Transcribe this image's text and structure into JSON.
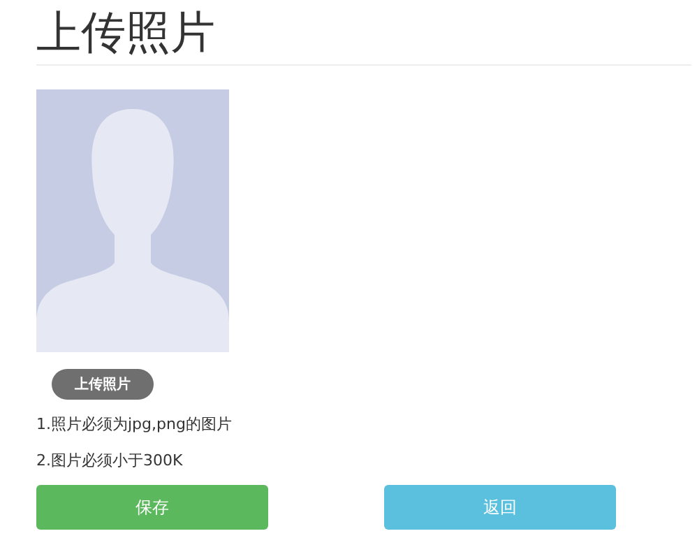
{
  "title": "上传照片",
  "upload_button": "上传照片",
  "notes": [
    "1.照片必须为jpg,png的图片",
    "2.图片必须小于300K"
  ],
  "buttons": [
    {
      "label": "保存",
      "kind": "success"
    },
    {
      "label": "返回",
      "kind": "info"
    }
  ]
}
